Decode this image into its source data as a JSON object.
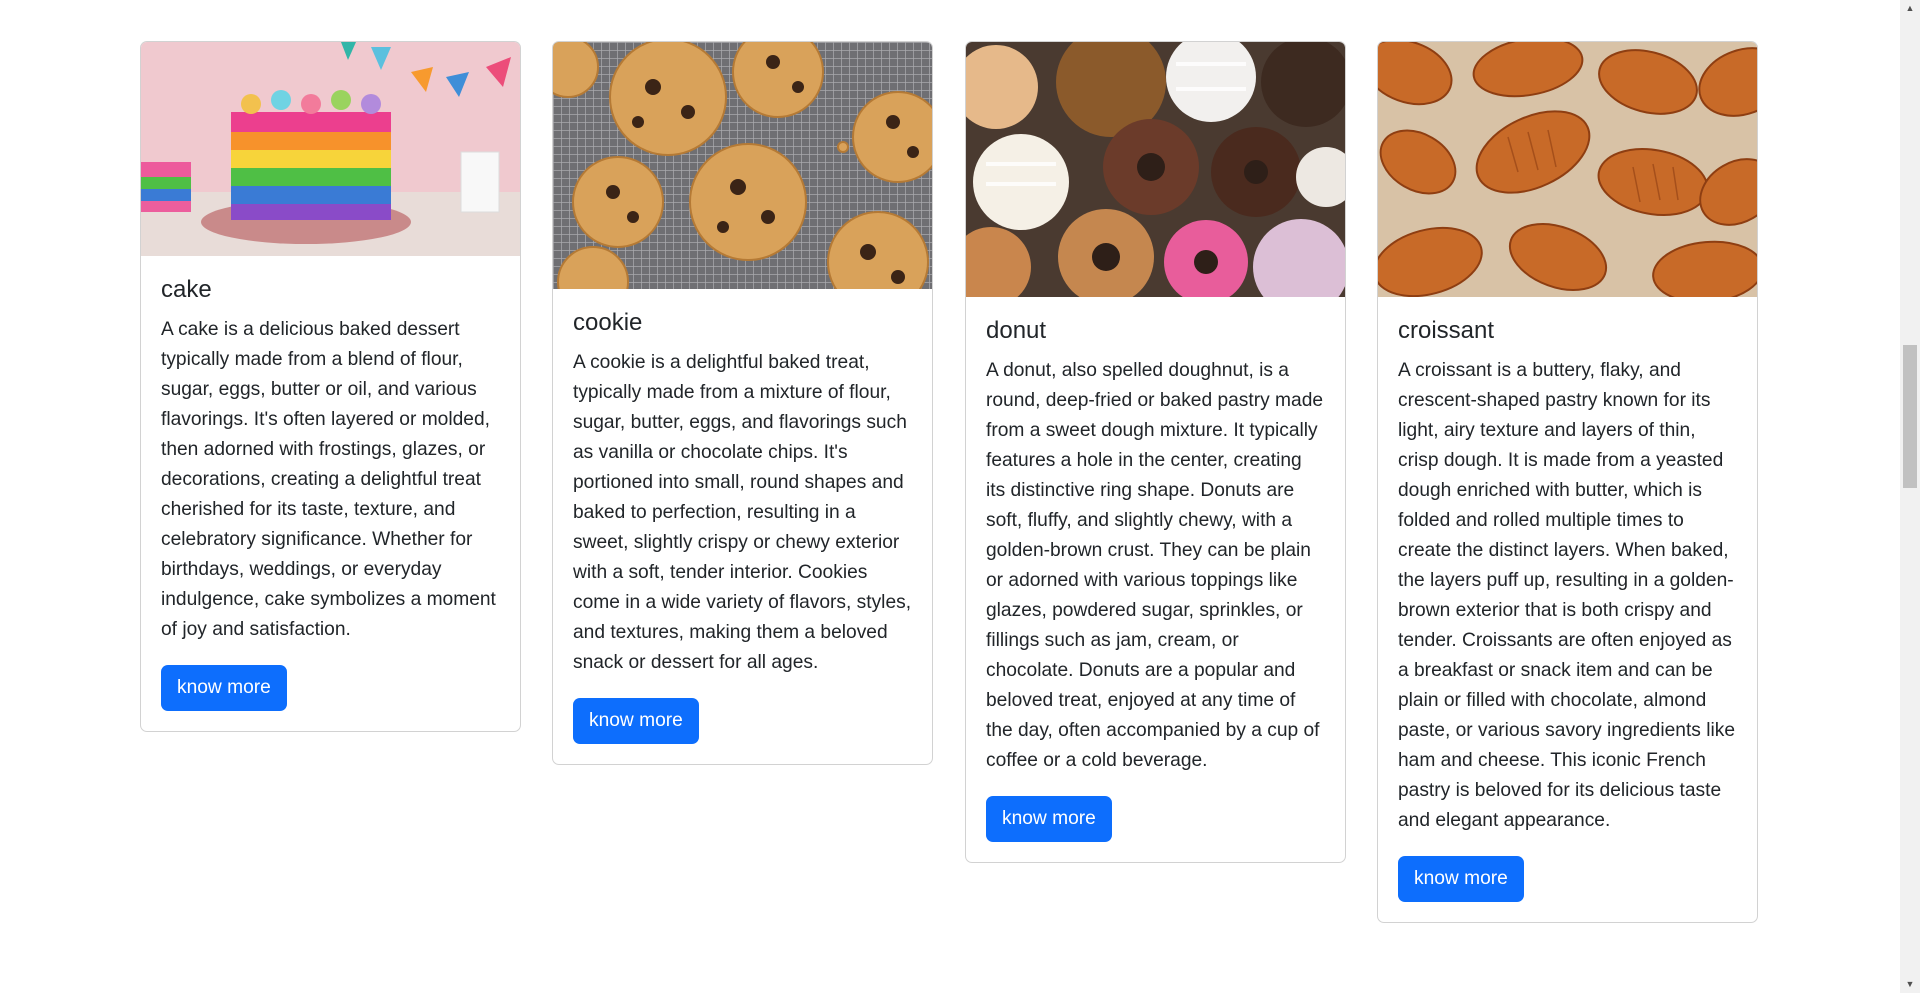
{
  "cards": [
    {
      "title": "cake",
      "image": "rainbow-layer-cake-photo",
      "text": "A cake is a delicious baked dessert typically made from a blend of flour, sugar, eggs, butter or oil, and various flavorings. It's often layered or molded, then adorned with frostings, glazes, or decorations, creating a delightful treat cherished for its taste, texture, and celebratory significance. Whether for birthdays, weddings, or everyday indulgence, cake symbolizes a moment of joy and satisfaction.",
      "button": "know more"
    },
    {
      "title": "cookie",
      "image": "chocolate-chip-cookies-photo",
      "text": "A cookie is a delightful baked treat, typically made from a mixture of flour, sugar, butter, eggs, and flavorings such as vanilla or chocolate chips. It's portioned into small, round shapes and baked to perfection, resulting in a sweet, slightly crispy or chewy exterior with a soft, tender interior. Cookies come in a wide variety of flavors, styles, and textures, making them a beloved snack or dessert for all ages.",
      "button": "know more"
    },
    {
      "title": "donut",
      "image": "assorted-donuts-photo",
      "text": "A donut, also spelled doughnut, is a round, deep-fried or baked pastry made from a sweet dough mixture. It typically features a hole in the center, creating its distinctive ring shape. Donuts are soft, fluffy, and slightly chewy, with a golden-brown crust. They can be plain or adorned with various toppings like glazes, powdered sugar, sprinkles, or fillings such as jam, cream, or chocolate. Donuts are a popular and beloved treat, enjoyed at any time of the day, often accompanied by a cup of coffee or a cold beverage.",
      "button": "know more"
    },
    {
      "title": "croissant",
      "image": "croissants-photo",
      "text": "A croissant is a buttery, flaky, and crescent-shaped pastry known for its light, airy texture and layers of thin, crisp dough. It is made from a yeasted dough enriched with butter, which is folded and rolled multiple times to create the distinct layers. When baked, the layers puff up, resulting in a golden-brown exterior that is both crispy and tender. Croissants are often enjoyed as a breakfast or snack item and can be plain or filled with chocolate, almond paste, or various savory ingredients like ham and cheese. This iconic French pastry is beloved for its delicious taste and elegant appearance.",
      "button": "know more"
    }
  ],
  "colors": {
    "primary_button": "#0d6efd",
    "text": "#212529",
    "scrollbar_track": "#f1f1f1",
    "scrollbar_thumb": "#c1c1c1"
  }
}
